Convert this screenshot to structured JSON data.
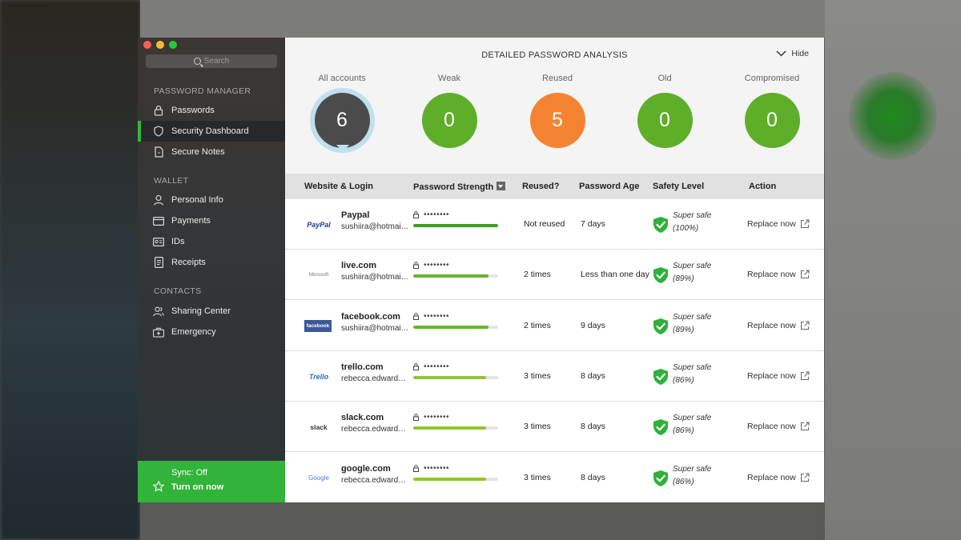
{
  "search": {
    "placeholder": "Search"
  },
  "sidebar": {
    "sections": [
      {
        "title": "PASSWORD MANAGER",
        "items": [
          {
            "label": "Passwords",
            "icon": "lock-icon"
          },
          {
            "label": "Security Dashboard",
            "icon": "shield-icon",
            "active": true
          },
          {
            "label": "Secure Notes",
            "icon": "note-icon"
          }
        ]
      },
      {
        "title": "WALLET",
        "items": [
          {
            "label": "Personal Info",
            "icon": "person-icon"
          },
          {
            "label": "Payments",
            "icon": "card-icon"
          },
          {
            "label": "IDs",
            "icon": "id-card-icon"
          },
          {
            "label": "Receipts",
            "icon": "receipt-icon"
          }
        ]
      },
      {
        "title": "CONTACTS",
        "items": [
          {
            "label": "Sharing Center",
            "icon": "people-icon"
          },
          {
            "label": "Emergency",
            "icon": "emergency-icon"
          }
        ]
      }
    ],
    "sync": {
      "status": "Sync: Off",
      "action": "Turn on now"
    }
  },
  "summary": {
    "title": "DETAILED PASSWORD ANALYSIS",
    "hide_label": "Hide",
    "stats": [
      {
        "label": "All accounts",
        "value": "6",
        "color": "#4b4b4b",
        "selected": true
      },
      {
        "label": "Weak",
        "value": "0",
        "color": "#5fae2a"
      },
      {
        "label": "Reused",
        "value": "5",
        "color": "#f38331"
      },
      {
        "label": "Old",
        "value": "0",
        "color": "#5fae2a"
      },
      {
        "label": "Compromised",
        "value": "0",
        "color": "#5fae2a"
      }
    ]
  },
  "table": {
    "headers": {
      "site": "Website & Login",
      "strength": "Password Strength",
      "reused": "Reused?",
      "age": "Password Age",
      "safety": "Safety Level",
      "action": "Action"
    },
    "password_mask": "••••••••",
    "rows": [
      {
        "logo": "PayPal",
        "site": "Paypal",
        "login": "sushiira@hotmail.com",
        "strength": 1.0,
        "bar_color": "#3a9e1f",
        "reused": "Not reused",
        "age": "7 days",
        "safety_label": "Super safe",
        "safety_pct": "(100%)",
        "action": "Replace now"
      },
      {
        "logo": "Microsoft",
        "site": "live.com",
        "login": "sushiira@hotmail.com",
        "strength": 0.89,
        "bar_color": "#69b52a",
        "reused": "2 times",
        "age": "Less than one day",
        "safety_label": "Super safe",
        "safety_pct": "(89%)",
        "action": "Replace now"
      },
      {
        "logo": "facebook",
        "site": "facebook.com",
        "login": "sushiira@hotmail.com",
        "strength": 0.89,
        "bar_color": "#69b52a",
        "reused": "2 times",
        "age": "9 days",
        "safety_label": "Super safe",
        "safety_pct": "(89%)",
        "action": "Replace now"
      },
      {
        "logo": "Trello",
        "site": "trello.com",
        "login": "rebecca.edwards@...",
        "strength": 0.86,
        "bar_color": "#93c42e",
        "reused": "3 times",
        "age": "8 days",
        "safety_label": "Super safe",
        "safety_pct": "(86%)",
        "action": "Replace now"
      },
      {
        "logo": "slack",
        "site": "slack.com",
        "login": "rebecca.edwards@...",
        "strength": 0.86,
        "bar_color": "#93c42e",
        "reused": "3 times",
        "age": "8 days",
        "safety_label": "Super safe",
        "safety_pct": "(86%)",
        "action": "Replace now"
      },
      {
        "logo": "Google",
        "site": "google.com",
        "login": "rebecca.edwards@...",
        "strength": 0.86,
        "bar_color": "#93c42e",
        "reused": "3 times",
        "age": "8 days",
        "safety_label": "Super safe",
        "safety_pct": "(86%)",
        "action": "Replace now"
      }
    ]
  }
}
